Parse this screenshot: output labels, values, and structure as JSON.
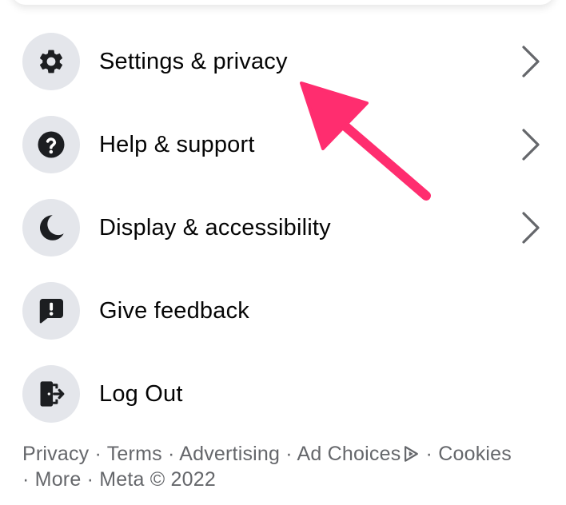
{
  "menu": {
    "items": [
      {
        "label": "Settings & privacy",
        "icon": "gear-icon",
        "has_chevron": true
      },
      {
        "label": "Help & support",
        "icon": "question-icon",
        "has_chevron": true
      },
      {
        "label": "Display & accessibility",
        "icon": "moon-icon",
        "has_chevron": true
      },
      {
        "label": "Give feedback",
        "icon": "feedback-icon",
        "has_chevron": false
      },
      {
        "label": "Log Out",
        "icon": "logout-icon",
        "has_chevron": false
      }
    ]
  },
  "footer": {
    "privacy": "Privacy",
    "terms": "Terms",
    "advertising": "Advertising",
    "ad_choices": "Ad Choices",
    "cookies": "Cookies",
    "more": "More",
    "meta": "Meta © 2022",
    "separator": " · "
  },
  "colors": {
    "icon_bg": "#e4e6eb",
    "text": "#050505",
    "secondary_text": "#65676b",
    "chevron": "#65676b",
    "annotation_arrow": "#ff2d6f"
  }
}
